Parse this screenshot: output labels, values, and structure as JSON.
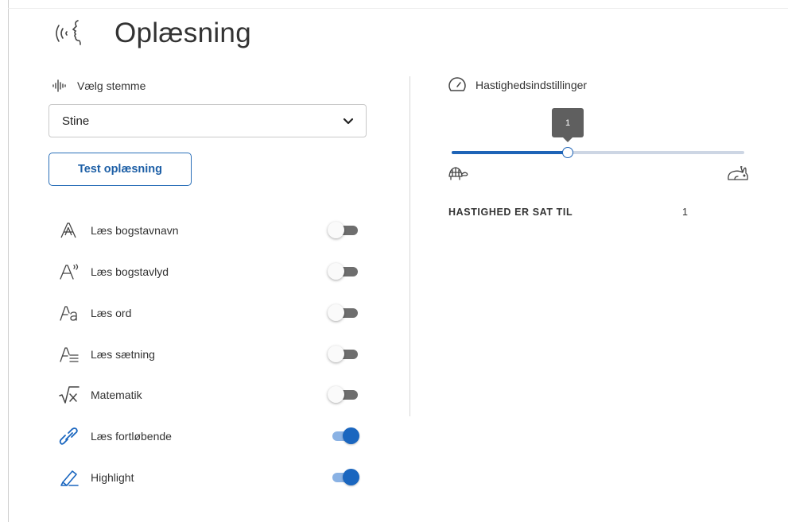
{
  "header": {
    "title": "Oplæsning",
    "icon": "speaking-head-icon"
  },
  "voice": {
    "label": "Vælg stemme",
    "icon": "waveform-icon",
    "selected": "Stine",
    "test_button": "Test oplæsning"
  },
  "options": [
    {
      "label": "Læs bogstavnavn",
      "icon": "letter-a-icon",
      "on": false
    },
    {
      "label": "Læs bogstavlyd",
      "icon": "letter-a-sound-icon",
      "on": false
    },
    {
      "label": "Læs ord",
      "icon": "word-icon",
      "on": false
    },
    {
      "label": "Læs sætning",
      "icon": "sentence-icon",
      "on": false
    },
    {
      "label": "Matematik",
      "icon": "square-root-icon",
      "on": false
    },
    {
      "label": "Læs fortløbende",
      "icon": "link-icon",
      "on": true
    },
    {
      "label": "Highlight",
      "icon": "highlighter-icon",
      "on": true
    }
  ],
  "speed": {
    "label": "Hastighedsindstillinger",
    "icon": "speedometer-icon",
    "slider_value": "1",
    "slider_fraction": 0.4,
    "min_icon": "turtle-icon",
    "max_icon": "rabbit-icon",
    "status_label": "HASTIGHED ER SAT TIL",
    "status_value": "1"
  },
  "colors": {
    "accent": "#1e64b7",
    "toggle_on_track": "#8ab2e4",
    "toggle_off_track": "#6e6e6e"
  }
}
